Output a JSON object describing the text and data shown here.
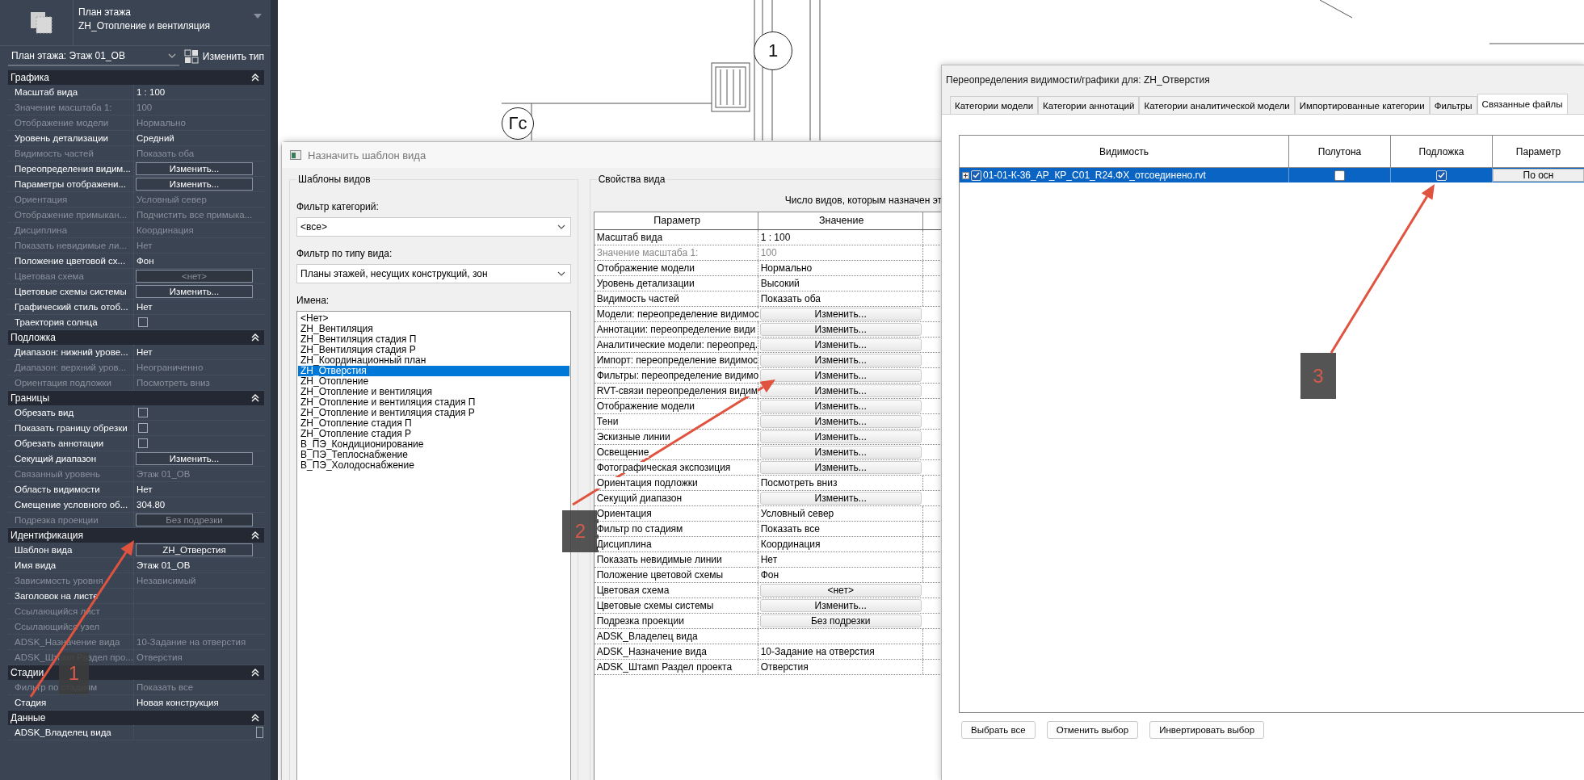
{
  "properties_palette": {
    "type_title": "План этажа",
    "type_name": "ZH_Отопление и вентиляция",
    "type_selector": "План этажа: Этаж 01_ОВ",
    "edit_type_button": "Изменить тип",
    "sections": [
      {
        "title": "Графика",
        "expanded": true,
        "rows": [
          {
            "label": "Масштаб вида",
            "kind": "text",
            "value": "1 : 100",
            "disabled": false
          },
          {
            "label": "Значение масштаба    1:",
            "kind": "text",
            "value": "100",
            "disabled": true
          },
          {
            "label": "Отображение модели",
            "kind": "text",
            "value": "Нормально",
            "disabled": true
          },
          {
            "label": "Уровень детализации",
            "kind": "text",
            "value": "Средний",
            "disabled": false
          },
          {
            "label": "Видимость частей",
            "kind": "text",
            "value": "Показать оба",
            "disabled": true
          },
          {
            "label": "Переопределения видим...",
            "kind": "button",
            "value": "Изменить...",
            "disabled": false
          },
          {
            "label": "Параметры отображени...",
            "kind": "button",
            "value": "Изменить...",
            "disabled": false
          },
          {
            "label": "Ориентация",
            "kind": "text",
            "value": "Условный север",
            "disabled": true
          },
          {
            "label": "Отображение примыкан...",
            "kind": "text",
            "value": "Подчистить все примыка...",
            "disabled": true
          },
          {
            "label": "Дисциплина",
            "kind": "text",
            "value": "Координация",
            "disabled": true
          },
          {
            "label": "Показать невидимые ли...",
            "kind": "text",
            "value": "Нет",
            "disabled": true
          },
          {
            "label": "Положение цветовой сх...",
            "kind": "text",
            "value": "Фон",
            "disabled": false
          },
          {
            "label": "Цветовая схема",
            "kind": "button",
            "value": "<нет>",
            "disabled": true
          },
          {
            "label": "Цветовые схемы системы",
            "kind": "button",
            "value": "Изменить...",
            "disabled": false
          },
          {
            "label": "Графический стиль отоб...",
            "kind": "text",
            "value": "Нет",
            "disabled": false
          },
          {
            "label": "Траектория солнца",
            "kind": "checkbox",
            "checked": false,
            "disabled": false
          }
        ]
      },
      {
        "title": "Подложка",
        "expanded": true,
        "rows": [
          {
            "label": "Диапазон: нижний урове...",
            "kind": "text",
            "value": "Нет",
            "disabled": false
          },
          {
            "label": "Диапазон: верхний уров...",
            "kind": "text",
            "value": "Неограниченно",
            "disabled": true
          },
          {
            "label": "Ориентация подложки",
            "kind": "text",
            "value": "Посмотреть вниз",
            "disabled": true
          }
        ]
      },
      {
        "title": "Границы",
        "expanded": true,
        "rows": [
          {
            "label": "Обрезать вид",
            "kind": "checkbox",
            "checked": false,
            "disabled": false
          },
          {
            "label": "Показать границу обрезки",
            "kind": "checkbox",
            "checked": false,
            "disabled": false
          },
          {
            "label": "Обрезать аннотации",
            "kind": "checkbox",
            "checked": false,
            "disabled": false
          },
          {
            "label": "Секущий диапазон",
            "kind": "button",
            "value": "Изменить...",
            "disabled": false
          },
          {
            "label": "Связанный уровень",
            "kind": "text",
            "value": "Этаж 01_ОВ",
            "disabled": true
          },
          {
            "label": "Область видимости",
            "kind": "text",
            "value": "Нет",
            "disabled": false
          },
          {
            "label": "Смещение условного об...",
            "kind": "text",
            "value": "304.80",
            "disabled": false
          },
          {
            "label": "Подрезка проекции",
            "kind": "button",
            "value": "Без подрезки",
            "disabled": true
          }
        ]
      },
      {
        "title": "Идентификация",
        "expanded": true,
        "rows": [
          {
            "label": "Шаблон вида",
            "kind": "button",
            "value": "ZH_Отверстия",
            "disabled": false
          },
          {
            "label": "Имя вида",
            "kind": "text",
            "value": "Этаж 01_ОВ",
            "disabled": false
          },
          {
            "label": "Зависимость уровня",
            "kind": "text",
            "value": "Независимый",
            "disabled": true
          },
          {
            "label": "Заголовок на листе",
            "kind": "text",
            "disabled": false
          },
          {
            "label": "Ссылающийся лист",
            "kind": "text",
            "disabled": true
          },
          {
            "label": "Ссылающийся узел",
            "kind": "text",
            "disabled": true
          },
          {
            "label": "ADSK_Назначение вида",
            "kind": "text",
            "value": "10-Задание на отверстия",
            "disabled": true
          },
          {
            "label": "ADSK_Штамп Раздел про...",
            "kind": "text",
            "value": "Отверстия",
            "disabled": true
          }
        ]
      },
      {
        "title": "Стадии",
        "expanded": true,
        "rows": [
          {
            "label": "Фильтр по стадиям",
            "kind": "text",
            "value": "Показать все",
            "disabled": true
          },
          {
            "label": "Стадия",
            "kind": "text",
            "value": "Новая конструкция",
            "disabled": false
          }
        ]
      },
      {
        "title": "Данные",
        "expanded": true,
        "rows": [
          {
            "label": "ADSK_Владелец вида",
            "kind": "field",
            "disabled": false
          }
        ]
      }
    ]
  },
  "canvas": {
    "grid_bubbles": [
      "1",
      "Гс"
    ]
  },
  "template_dialog": {
    "title": "Назначить шаблон вида",
    "templates_group": "Шаблоны видов",
    "category_filter_label": "Фильтр категорий:",
    "category_filter": "<все>",
    "view_type_filter_label": "Фильтр по типу вида:",
    "view_type_filter": "Планы этажей, несущих конструкций, зон",
    "names_label": "Имена:",
    "names": [
      {
        "label": "<Нет>",
        "selected": false
      },
      {
        "label": "ZH_Вентиляция",
        "selected": false
      },
      {
        "label": "ZH_Вентиляция стадия П",
        "selected": false
      },
      {
        "label": "ZH_Вентиляция стадия Р",
        "selected": false
      },
      {
        "label": "ZH_Координационный план",
        "selected": false
      },
      {
        "label": "ZH_Отверстия",
        "selected": true
      },
      {
        "label": "ZH_Отопление",
        "selected": false
      },
      {
        "label": "ZH_Отопление и вентиляция",
        "selected": false
      },
      {
        "label": "ZH_Отопление и вентиляция стадия П",
        "selected": false
      },
      {
        "label": "ZH_Отопление и вентиляция стадия Р",
        "selected": false
      },
      {
        "label": "ZH_Отопление стадия П",
        "selected": false
      },
      {
        "label": "ZH_Отопление стадия Р",
        "selected": false
      },
      {
        "label": "В_ПЭ_Кондиционирование",
        "selected": false
      },
      {
        "label": "В_ПЭ_Теплоснабжение",
        "selected": false
      },
      {
        "label": "В_ПЭ_Холодоснабжение",
        "selected": false
      }
    ],
    "properties_group": "Свойства вида",
    "views_count_text": "Число видов, которым назначен эт",
    "columns": [
      "Параметр",
      "Значение"
    ],
    "rows": [
      {
        "parameter": "Масштаб вида",
        "kind": "text",
        "value": "1 : 100",
        "disabled": false
      },
      {
        "parameter": "Значение масштаба    1:",
        "kind": "text",
        "value": "100",
        "disabled": true
      },
      {
        "parameter": "Отображение модели",
        "kind": "text",
        "value": "Нормально",
        "disabled": false
      },
      {
        "parameter": "Уровень детализации",
        "kind": "text",
        "value": "Высокий",
        "disabled": false
      },
      {
        "parameter": "Видимость частей",
        "kind": "text",
        "value": "Показать оба",
        "disabled": false
      },
      {
        "parameter": "Модели: переопределение видимос",
        "kind": "button",
        "value": "Изменить...",
        "disabled": false
      },
      {
        "parameter": "Аннотации: переопределение види",
        "kind": "button",
        "value": "Изменить...",
        "disabled": false
      },
      {
        "parameter": "Аналитические модели: переопред.",
        "kind": "button",
        "value": "Изменить...",
        "disabled": false
      },
      {
        "parameter": "Импорт: переопределение видимос",
        "kind": "button",
        "value": "Изменить...",
        "disabled": false
      },
      {
        "parameter": "Фильтры: переопределение видимо",
        "kind": "button",
        "value": "Изменить...",
        "disabled": false
      },
      {
        "parameter": "RVT-связи переопределения видим",
        "kind": "button",
        "value": "Изменить...",
        "disabled": false
      },
      {
        "parameter": "Отображение модели",
        "kind": "button",
        "value": "Изменить...",
        "disabled": false
      },
      {
        "parameter": "Тени",
        "kind": "button",
        "value": "Изменить...",
        "disabled": false
      },
      {
        "parameter": "Эскизные линии",
        "kind": "button",
        "value": "Изменить...",
        "disabled": false
      },
      {
        "parameter": "Освещение",
        "kind": "button",
        "value": "Изменить...",
        "disabled": false
      },
      {
        "parameter": "Фотографическая экспозиция",
        "kind": "button",
        "value": "Изменить...",
        "disabled": false
      },
      {
        "parameter": "Ориентация подложки",
        "kind": "text",
        "value": "Посмотреть вниз",
        "disabled": false
      },
      {
        "parameter": "Секущий диапазон",
        "kind": "button",
        "value": "Изменить...",
        "disabled": false
      },
      {
        "parameter": "Ориентация",
        "kind": "text",
        "value": "Условный север",
        "disabled": false
      },
      {
        "parameter": "Фильтр по стадиям",
        "kind": "text",
        "value": "Показать все",
        "disabled": false
      },
      {
        "parameter": "Дисциплина",
        "kind": "text",
        "value": "Координация",
        "disabled": false
      },
      {
        "parameter": "Показать невидимые линии",
        "kind": "text",
        "value": "Нет",
        "disabled": false
      },
      {
        "parameter": "Положение цветовой схемы",
        "kind": "text",
        "value": "Фон",
        "disabled": false
      },
      {
        "parameter": "Цветовая схема",
        "kind": "button",
        "value": "<нет>",
        "disabled": false
      },
      {
        "parameter": "Цветовые схемы системы",
        "kind": "button",
        "value": "Изменить...",
        "disabled": false
      },
      {
        "parameter": "Подрезка проекции",
        "kind": "button",
        "value": "Без подрезки",
        "disabled": false
      },
      {
        "parameter": "ADSK_Владелец вида",
        "kind": "text",
        "disabled": false
      },
      {
        "parameter": "ADSK_Назначение вида",
        "kind": "text",
        "value": "10-Задание на отверстия",
        "disabled": false
      },
      {
        "parameter": "ADSK_Штамп Раздел проекта",
        "kind": "text",
        "value": "Отверстия",
        "disabled": false
      }
    ]
  },
  "vg_dialog": {
    "title": "Переопределения видимости/графики для: ZH_Отверстия",
    "tabs": [
      {
        "label": "Категории модели",
        "selected": false
      },
      {
        "label": "Категории аннотаций",
        "selected": false
      },
      {
        "label": "Категории аналитической модели",
        "selected": false
      },
      {
        "label": "Импортированные категории",
        "selected": false
      },
      {
        "label": "Фильтры",
        "selected": false
      },
      {
        "label": "Связанные файлы",
        "selected": true
      }
    ],
    "columns": [
      "Видимость",
      "Полутона",
      "Подложка",
      "Параметр"
    ],
    "rows": [
      {
        "name": "01-01-К-36_АР_КР_С01_R24.ФХ_отсоединено.rvt",
        "expanded": false,
        "visible": true,
        "halftone": false,
        "underlay": true,
        "settings_button": "По осн",
        "selected": true
      }
    ],
    "buttons": [
      "Выбрать все",
      "Отменить выбор",
      "Инвертировать выбор"
    ]
  },
  "annotations": [
    {
      "label": "1"
    },
    {
      "label": "2"
    },
    {
      "label": "3"
    }
  ]
}
